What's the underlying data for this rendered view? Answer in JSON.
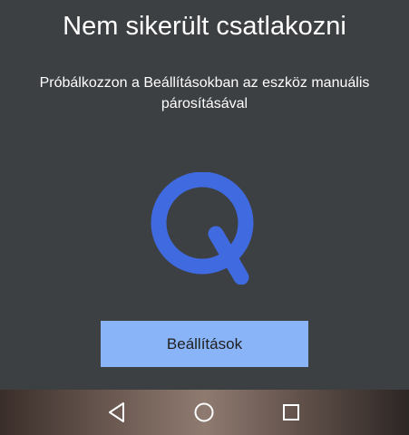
{
  "dialog": {
    "title": "Nem sikerült csatlakozni",
    "message": "Próbálkozzon a Beállításokban az eszköz manuális párosításával",
    "logo_icon": "qualcomm-q-logo",
    "logo_color": "#3f6ae0",
    "settings_button_label": "Beállítások",
    "button_color": "#8ab4f8",
    "background_color": "#3d4043"
  },
  "navbar": {
    "back_icon": "triangle-back-icon",
    "home_icon": "circle-home-icon",
    "recents_icon": "square-recents-icon"
  }
}
